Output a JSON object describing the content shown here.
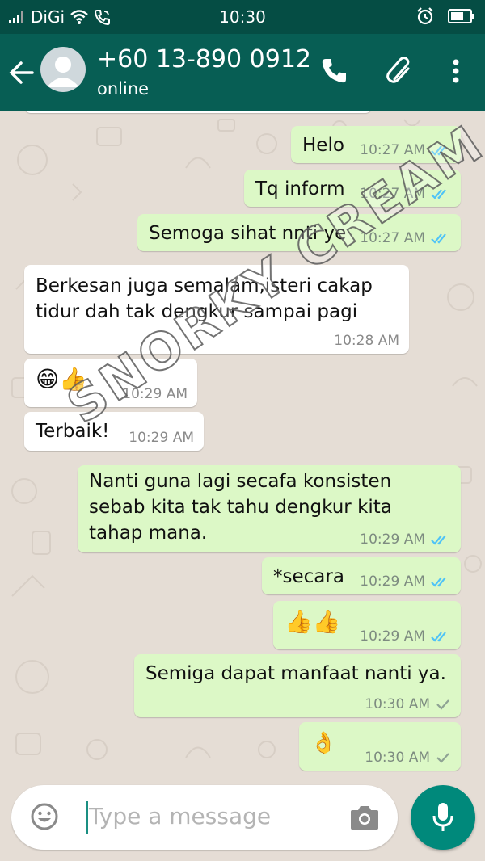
{
  "status_bar": {
    "carrier": "DiGi",
    "time": "10:30"
  },
  "header": {
    "contact_name": "+60 13-890 0912",
    "status": "online"
  },
  "messages": [
    {
      "direction": "out",
      "text": "Helo",
      "time": "10:27 AM",
      "receipt": "read"
    },
    {
      "direction": "out",
      "text": "Tq inform",
      "time": "10:27 AM",
      "receipt": "read"
    },
    {
      "direction": "out",
      "text": "Semoga sihat nnti ye",
      "time": "10:27 AM",
      "receipt": "read"
    },
    {
      "direction": "in",
      "text": "Berkesan juga semalam,isteri cakap\ntidur dah tak dengkur sampai pagi",
      "time": "10:28 AM"
    },
    {
      "direction": "in",
      "text": "😁👍",
      "time": "10:29 AM"
    },
    {
      "direction": "in",
      "text": "Terbaik!",
      "time": "10:29 AM"
    },
    {
      "direction": "out",
      "text": "Nanti guna lagi secafa konsisten\nsebab kita tak tahu dengkur kita\ntahap mana.",
      "time": "10:29 AM",
      "receipt": "read"
    },
    {
      "direction": "out",
      "text": "*secara",
      "time": "10:29 AM",
      "receipt": "read"
    },
    {
      "direction": "out",
      "text": "👍👍",
      "time": "10:29 AM",
      "receipt": "read"
    },
    {
      "direction": "out",
      "text": "Semiga dapat manfaat nanti ya.",
      "time": "10:30 AM",
      "receipt": "delivered"
    },
    {
      "direction": "out",
      "text": "👌",
      "time": "10:30 AM",
      "receipt": "delivered"
    }
  ],
  "watermark": "SNORKY CREAM",
  "composer": {
    "placeholder": "Type a message"
  },
  "icons": {
    "back": "arrow-left-icon",
    "call": "phone-icon",
    "attach": "paperclip-icon",
    "menu": "more-vert-icon",
    "emoji": "emoji-icon",
    "camera": "camera-icon",
    "mic": "mic-icon"
  },
  "colors": {
    "status_bar": "#054d44",
    "app_bar": "#075e54",
    "outgoing_bubble": "#dcf8c6",
    "incoming_bubble": "#ffffff",
    "read_tick": "#4fc3f7",
    "mic_button": "#00897b",
    "chat_background": "#e5ddd5"
  }
}
